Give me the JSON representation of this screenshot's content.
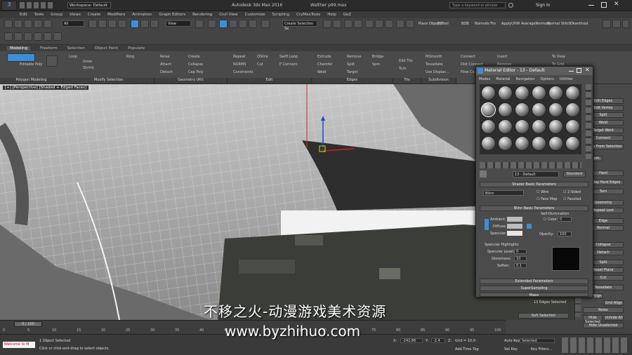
{
  "app": {
    "title": "Autodesk 3ds Max 2016",
    "file": "Walther p99.max",
    "workspace": "Workspace: Default",
    "search_placeholder": "Type a keyword or phrase",
    "sign_in": "Sign In"
  },
  "menu": [
    "Edit",
    "Tools",
    "Group",
    "Views",
    "Create",
    "Modifiers",
    "Animation",
    "Graph Editors",
    "Rendering",
    "Civil View",
    "Customize",
    "Scripting",
    "CryMaxTools",
    "Help",
    "GoZ"
  ],
  "toolbar": {
    "selection_set": "All",
    "view": "View",
    "named_selection": "Create Selection Se",
    "right_labels": [
      "Place Objects",
      "3DTool",
      "BOB",
      "Normals Fro",
      "ApplyUVW",
      "AverageNormals",
      "Normal Stitch",
      "Okanthost"
    ]
  },
  "ribbon": {
    "tabs": [
      "Modeling",
      "Freeform",
      "Selection",
      "Object Paint",
      "Populate"
    ],
    "active_tab": "Modeling",
    "editable_poly": "Editable Poly",
    "loop": "Loop",
    "ring": "Ring",
    "grow": "Grow",
    "shrink": "Shrink",
    "geometry": [
      "Relax",
      "Create",
      "Attach",
      "Collapse",
      "Detach",
      "Cap Poly"
    ],
    "edit": [
      "Repeat",
      "QSlice",
      "Swift Loop",
      "NURMS",
      "Cut",
      "P Connect",
      "Constraints"
    ],
    "edges": [
      "Extrude",
      "Remove",
      "Bridge",
      "Chamfer",
      "Split",
      "Spin",
      "Weld",
      "Target"
    ],
    "tris": [
      "Edit Tris",
      "Turn"
    ],
    "subdivision": [
      "MSmooth",
      "Tessellate",
      "Use Displac..."
    ],
    "connect": [
      "Connect",
      "Dist Connect",
      "Flow Co..."
    ],
    "insert": "Insert",
    "to_view": [
      "To View",
      "To Grid"
    ],
    "groups": [
      "Polygon Modeling",
      "Modify Selection",
      "Geometry (All)",
      "Edit",
      "Edges",
      "Tris",
      "Subdivision"
    ],
    "remove": "Remove"
  },
  "viewport": {
    "label": "[+] [Perspective] [Shaded + Edged Faces]"
  },
  "material_editor": {
    "title": "Material Editor - 13 - Default",
    "menu": [
      "Modes",
      "Material",
      "Navigation",
      "Options",
      "Utilities"
    ],
    "material_name": "13 - Default",
    "material_type": "Standard",
    "shader_rollout": "Shader Basic Parameters",
    "shader": "Blinn",
    "checks": [
      "Wire",
      "2-Sided",
      "Face Map",
      "Faceted"
    ],
    "blinn_rollout": "Blinn Basic Parameters",
    "self_illum": "Self-Illumination",
    "color_label": "Color",
    "color_value": "0",
    "ambient": "Ambient:",
    "diffuse": "Diffuse:",
    "specular": "Specular:",
    "opacity_label": "Opacity:",
    "opacity_value": "100",
    "spec_highlights": "Specular Highlights",
    "spec_level_label": "Specular Level:",
    "spec_level": "0",
    "glossiness_label": "Glossiness:",
    "glossiness": "10",
    "soften_label": "Soften:",
    "soften": "0.1",
    "rollouts": [
      "Extended Parameters",
      "SuperSampling",
      "Maps"
    ]
  },
  "command_panel": {
    "items": [
      "Edit Edges",
      "Edit Vertex",
      "Split",
      "Weld",
      "Target Weld",
      "Connect",
      "Edges From Selection",
      "Smooth",
      "Hard",
      "Display Hard Edges",
      "Turn",
      "Geometry",
      "Repeat Last",
      "Edge",
      "Normal",
      "Collapse",
      "Detach",
      "Split",
      "Reset Plane",
      "Cut",
      "Tessellate",
      "View Align",
      "Grid Align",
      "Relax",
      "Hide Selected",
      "Unhide All",
      "Hide Unselected",
      "13 Edges Selected",
      "Soft Selection"
    ]
  },
  "timeline": {
    "frame": "0 / 100",
    "ticks": [
      "0",
      "5",
      "10",
      "15",
      "20",
      "25",
      "30",
      "35",
      "40",
      "45",
      "50",
      "55",
      "60",
      "65",
      "70",
      "75",
      "80",
      "85",
      "90",
      "95",
      "100"
    ]
  },
  "status": {
    "listener": "Welcome to M",
    "selected": "1 Object Selected",
    "prompt": "Click or click-and-drag to select objects",
    "x": "X:",
    "y": "Y:",
    "z": "Z:",
    "x_val": "-242.86",
    "y_val": "-2.4",
    "grid": "Grid = 10.0",
    "auto_key": "Auto Key",
    "set_key": "Set Key",
    "key_mode": "Selected",
    "key_filters": "Key Filters...",
    "add_time_tag": "Add Time Tag"
  },
  "watermark": {
    "cn": "不移之火-动漫游戏美术资源",
    "url": "www.byzhihuo.com"
  },
  "colors": {
    "accent": "#3b8fd9",
    "viewport": "#6a6a6a",
    "grip_dark": "#3a3d38"
  }
}
